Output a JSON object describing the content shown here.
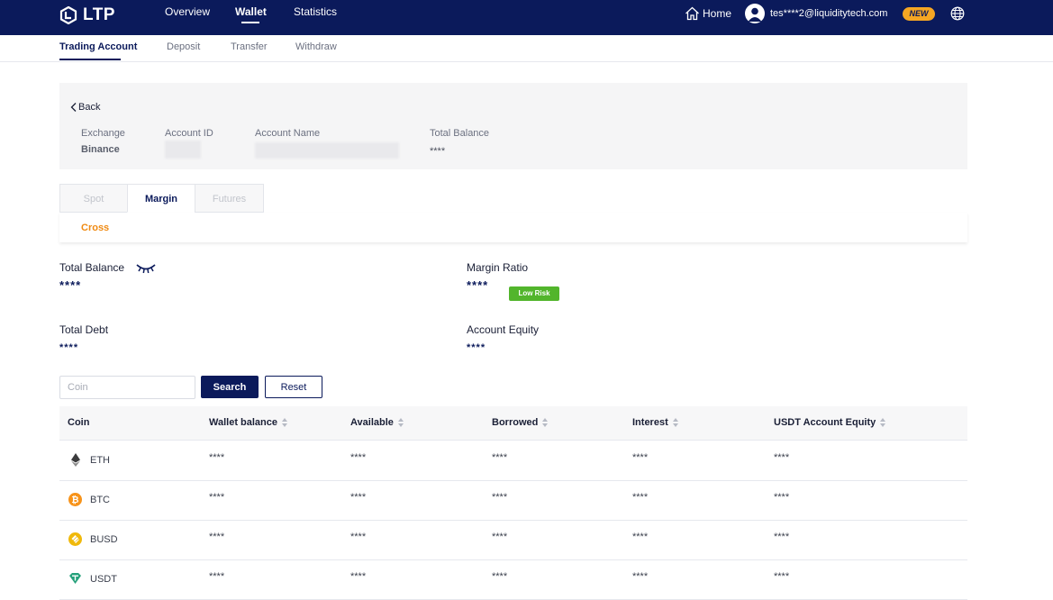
{
  "brand": {
    "logo_text": "LTP"
  },
  "topnav": {
    "items": [
      {
        "label": "Overview"
      },
      {
        "label": "Wallet"
      },
      {
        "label": "Statistics"
      }
    ],
    "home_label": "Home",
    "user_email": "tes****2@liquiditytech.com",
    "new_badge": "NEW"
  },
  "subnav": {
    "items": [
      {
        "label": "Trading Account"
      },
      {
        "label": "Deposit"
      },
      {
        "label": "Transfer"
      },
      {
        "label": "Withdraw"
      }
    ]
  },
  "account": {
    "back_label": "Back",
    "exchange_label": "Exchange",
    "exchange_value": "Binance",
    "account_id_label": "Account ID",
    "account_name_label": "Account Name",
    "total_balance_label": "Total Balance",
    "total_balance_value": "****"
  },
  "tabs": [
    {
      "label": "Spot"
    },
    {
      "label": "Margin"
    },
    {
      "label": "Futures"
    }
  ],
  "margin_mode": "Cross",
  "stats": {
    "total_balance_label": "Total Balance",
    "total_balance_value": "****",
    "margin_ratio_label": "Margin Ratio",
    "margin_ratio_value": "****",
    "risk_badge": "Low Risk",
    "total_debt_label": "Total Debt",
    "total_debt_value": "****",
    "account_equity_label": "Account Equity",
    "account_equity_value": "****"
  },
  "filters": {
    "coin_placeholder": "Coin",
    "search_label": "Search",
    "reset_label": "Reset"
  },
  "table": {
    "columns": [
      "Coin",
      "Wallet balance",
      "Available",
      "Borrowed",
      "Interest",
      "USDT Account Equity"
    ],
    "rows": [
      {
        "coin": "ETH",
        "wallet_balance": "****",
        "available": "****",
        "borrowed": "****",
        "interest": "****",
        "equity": "****"
      },
      {
        "coin": "BTC",
        "wallet_balance": "****",
        "available": "****",
        "borrowed": "****",
        "interest": "****",
        "equity": "****"
      },
      {
        "coin": "BUSD",
        "wallet_balance": "****",
        "available": "****",
        "borrowed": "****",
        "interest": "****",
        "equity": "****"
      },
      {
        "coin": "USDT",
        "wallet_balance": "****",
        "available": "****",
        "borrowed": "****",
        "interest": "****",
        "equity": "****"
      }
    ]
  },
  "colors": {
    "navy": "#0b1a5b",
    "accent_orange": "#f08a12",
    "new_badge": "#f5a623",
    "low_risk_green": "#52b52c"
  }
}
